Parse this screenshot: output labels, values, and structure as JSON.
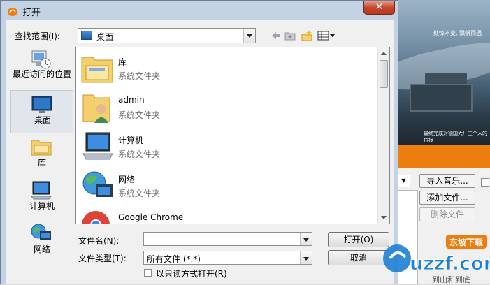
{
  "dialog": {
    "title": "打开",
    "close_glyph": "✕",
    "look_in_label": "查找范围(I):",
    "look_in_value": "桌面",
    "file_name_label": "文件名(N):",
    "file_name_value": "",
    "file_type_label": "文件类型(T):",
    "file_type_value": "所有文件 (*.*)",
    "readonly_label": "以只读方式打开(R)",
    "open_button": "打开(O)",
    "cancel_button": "取消"
  },
  "places": [
    {
      "label": "最近访问的位置",
      "icon": "recent-places-icon"
    },
    {
      "label": "桌面",
      "icon": "desktop-icon",
      "selected": true
    },
    {
      "label": "库",
      "icon": "libraries-icon"
    },
    {
      "label": "计算机",
      "icon": "computer-icon"
    },
    {
      "label": "网络",
      "icon": "network-icon"
    }
  ],
  "files": [
    {
      "name": "库",
      "type": "系统文件夹",
      "icon": "libraries-icon"
    },
    {
      "name": "admin",
      "type": "系统文件夹",
      "icon": "user-folder-icon"
    },
    {
      "name": "计算机",
      "type": "系统文件夹",
      "icon": "computer-icon"
    },
    {
      "name": "网络",
      "type": "系统文件夹",
      "icon": "network-icon"
    },
    {
      "name": "Google Chrome",
      "type": "",
      "icon": "chrome-icon"
    }
  ],
  "background_app": {
    "import_music_button": "导入音乐...",
    "add_file_button": "添加文件...",
    "delete_file_button": "删除文件",
    "banner_caption_1": "处惊不变, 飘帆而遇",
    "banner_caption_2": "最终完成对德国大厂三个人的拉拢",
    "banner_footer": "到山和到底"
  },
  "watermark": {
    "text": "uzzf.com",
    "badge": "东坡下载"
  },
  "colors": {
    "accent_blue": "#1d7fd6",
    "watermark_orange": "#ee7d10",
    "close_red": "#c7482e"
  }
}
